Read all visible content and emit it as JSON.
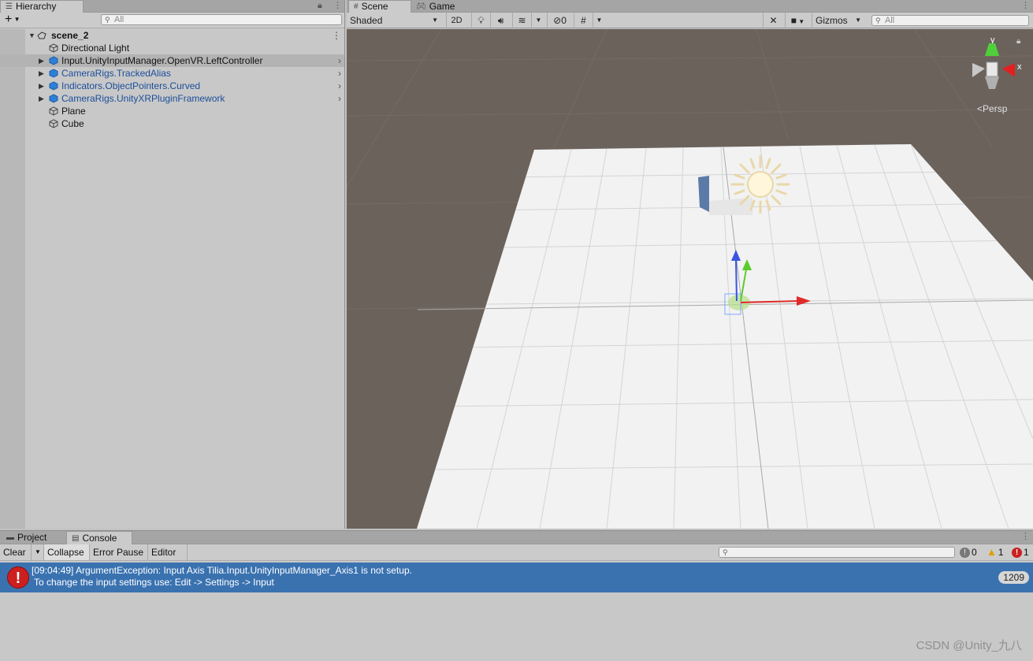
{
  "hierarchy": {
    "tab_label": "Hierarchy",
    "add_label": "+",
    "search_placeholder": "All",
    "scene_name": "scene_2",
    "items": [
      {
        "label": "Directional Light",
        "type": "object"
      },
      {
        "label": "Input.UnityInputManager.OpenVR.LeftController",
        "type": "object",
        "selected": true
      },
      {
        "label": "CameraRigs.TrackedAlias",
        "type": "prefab"
      },
      {
        "label": "Indicators.ObjectPointers.Curved",
        "type": "prefab"
      },
      {
        "label": "CameraRigs.UnityXRPluginFramework",
        "type": "prefab"
      },
      {
        "label": "Plane",
        "type": "object"
      },
      {
        "label": "Cube",
        "type": "object"
      }
    ]
  },
  "scene": {
    "tabs": [
      {
        "label": "Scene",
        "icon": "grid-icon",
        "active": true
      },
      {
        "label": "Game",
        "icon": "gamepad-icon",
        "active": false
      }
    ],
    "toolbar": {
      "shading_mode": "Shaded",
      "mode_2d": "2D",
      "hidden_count": "0",
      "gizmos_label": "Gizmos",
      "search_placeholder": "All"
    },
    "orientation_gizmo": {
      "y_label": "y",
      "x_label": "x",
      "projection_label": "Persp"
    }
  },
  "console": {
    "tabs": [
      {
        "label": "Project",
        "icon": "folder-icon",
        "active": false
      },
      {
        "label": "Console",
        "icon": "console-icon",
        "active": true
      }
    ],
    "toolbar": {
      "clear": "Clear",
      "collapse": "Collapse",
      "error_pause": "Error Pause",
      "editor": "Editor",
      "info_count": "0",
      "warning_count": "1",
      "error_count": "1"
    },
    "log": {
      "line1": "[09:04:49] ArgumentException: Input Axis Tilia.Input.UnityInputManager_Axis1 is not setup.",
      "line2": "To change the input settings use: Edit -> Settings -> Input",
      "count": "1209"
    }
  },
  "watermark": "CSDN @Unity_九八",
  "colors": {
    "viewport_bg": "#6b625c",
    "plane": "#f2f2f2",
    "selection_blue": "#3a72b0",
    "prefab_text": "#1b4e9b",
    "error_red": "#cc1f1f"
  }
}
